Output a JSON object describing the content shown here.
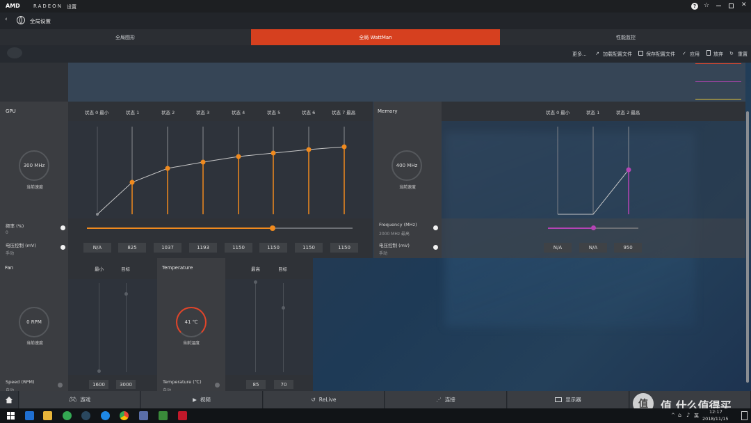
{
  "titlebar": {
    "brand": "AMD",
    "radeon": "RADEON",
    "settings": "设置"
  },
  "header": {
    "title": "全局设置"
  },
  "tabs": [
    "全局图形",
    "全局 WattMan",
    "性能监控"
  ],
  "toolbar": {
    "more": "更多...",
    "load": "加载配置文件",
    "save": "保存配置文件",
    "apply": "应用",
    "discard": "放弃",
    "reset": "重置"
  },
  "gpu": {
    "title": "GPU",
    "states": [
      "状态 0 最小",
      "状态 1",
      "状态 2",
      "状态 3",
      "状态 4",
      "状态 5",
      "状态 6",
      "状态 7 最高"
    ],
    "gauge": "300 MHz",
    "gauge_label": "当前速度",
    "freq_label": "频率 (%)",
    "freq_value": "0",
    "volt_label": "电压控制 (mV)",
    "volt_mode": "手动",
    "voltages": [
      "N/A",
      "825",
      "1037",
      "1193",
      "1150",
      "1150",
      "1150",
      "1150"
    ],
    "freq_slider_fraction": 0.7,
    "accent": "#f08a1e"
  },
  "memory": {
    "title": "Memory",
    "states": [
      "状态 0 最小",
      "状态 1",
      "状态 2 最高"
    ],
    "gauge": "400 MHz",
    "gauge_label": "当前速度",
    "freq_label": "Frequency (MHz)",
    "freq_value": "2000 MHz 最高",
    "volt_label": "电压控制 (mV)",
    "volt_mode": "手动",
    "voltages": [
      "N/A",
      "N/A",
      "950"
    ],
    "freq_slider_fraction": 0.5,
    "accent": "#b544b5"
  },
  "fan": {
    "title": "Fan",
    "cols": [
      "最小",
      "目标"
    ],
    "gauge": "0 RPM",
    "gauge_label": "当前速度",
    "speed_label": "Speed (RPM)",
    "speed_mode": "自动",
    "values": [
      "1600",
      "3000"
    ]
  },
  "temperature": {
    "title": "Temperature",
    "cols": [
      "最高",
      "目标"
    ],
    "gauge": "41 ℃",
    "gauge_label": "当前温度",
    "temp_label": "Temperature (℃)",
    "temp_mode": "自动",
    "values": [
      "85",
      "70"
    ],
    "accent": "#e0452a"
  },
  "bottomnav": [
    "游戏",
    "视频",
    "ReLive",
    "连接",
    "显示器"
  ],
  "watermark": "值 什么值得买",
  "taskbar": {
    "time": "12:17",
    "date": "2018/11/15",
    "ime": "英"
  }
}
